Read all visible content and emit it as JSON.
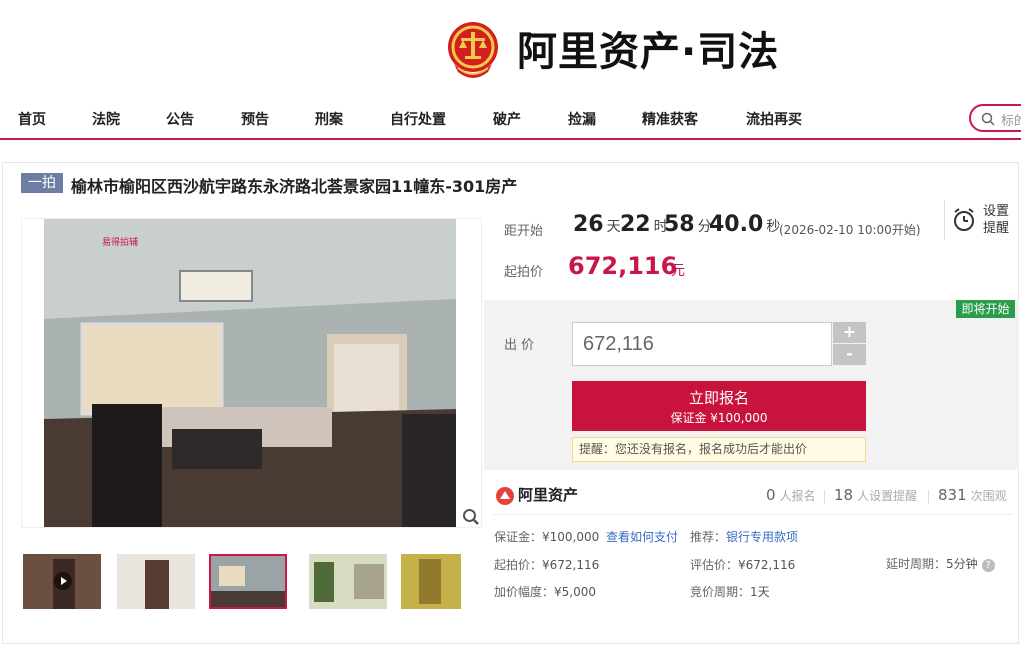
{
  "brand": {
    "name": "阿里资产·司法",
    "emblem_icon": "court-emblem-icon",
    "emblem_color": "#d22020"
  },
  "nav": {
    "items": [
      "首页",
      "法院",
      "公告",
      "预告",
      "刑案",
      "自行处置",
      "破产",
      "捡漏",
      "精准获客",
      "流拍再买"
    ]
  },
  "search": {
    "placeholder": "标的"
  },
  "listing": {
    "round_tag": "一拍",
    "title": "榆林市榆阳区西沙航宇路东永济路北荟景家园11幢东-301房产",
    "watermark": "易得拍辅"
  },
  "countdown": {
    "label": "距开始",
    "days": "26",
    "days_unit": "天",
    "hours": "22",
    "hours_unit": "时",
    "minutes": "58",
    "minutes_unit": "分",
    "seconds": "40.0",
    "seconds_unit": "秒",
    "note": "(2026-02-10 10:00开始)"
  },
  "start_price": {
    "label": "起拍价",
    "value": "672,116",
    "unit": "元"
  },
  "remind": {
    "line1": "设置",
    "line2": "提醒",
    "icon": "alarm-clock-icon"
  },
  "status_badge": "即将开始",
  "bid": {
    "label": "出 价",
    "value": "672,116",
    "plus": "+",
    "minus": "-",
    "signup_label": "立即报名",
    "deposit_label": "保证金 ¥100,000",
    "warning": "提醒：您还没有报名，报名成功后才能出价"
  },
  "platform": {
    "name": "阿里资产"
  },
  "stats": {
    "signups": "0",
    "signups_label": "人报名",
    "reminders": "18",
    "reminders_label": "人设置提醒",
    "views": "831",
    "views_label": "次围观"
  },
  "info": {
    "deposit_k": "保证金：",
    "deposit_v": "¥100,000",
    "how_pay": "查看如何支付",
    "recommend_k": "推荐：",
    "recommend_v": "银行专用款项",
    "start_price_k": "起拍价：",
    "start_price_v": "¥672,116",
    "eval_k": "评估价：",
    "eval_v": "¥672,116",
    "delay_k": "延时周期：",
    "delay_v": "5分钟",
    "increment_k": "加价幅度：",
    "increment_v": "¥5,000",
    "cycle_k": "竞价周期：",
    "cycle_v": "1天"
  },
  "colors": {
    "accent": "#c8174a",
    "signup_button": "#c8133c",
    "badge_green": "#2a9d4a",
    "tag_bg": "#6e7da3"
  }
}
